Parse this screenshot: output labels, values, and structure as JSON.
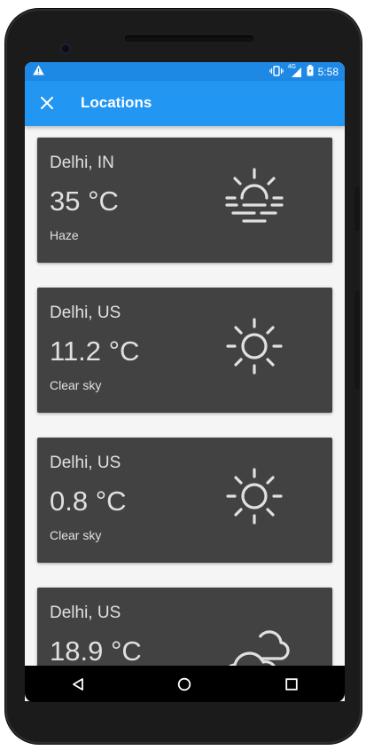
{
  "status_bar": {
    "time": "5:58",
    "network": "4G",
    "icons": [
      "warning-icon",
      "vibrate-icon",
      "signal-icon",
      "battery-icon"
    ]
  },
  "app_bar": {
    "title": "Locations",
    "close_icon": "close-icon"
  },
  "locations": [
    {
      "location": "Delhi, IN",
      "temperature": "35 °C",
      "description": "Haze",
      "icon": "haze-icon"
    },
    {
      "location": "Delhi, US",
      "temperature": "11.2 °C",
      "description": "Clear sky",
      "icon": "sun-icon"
    },
    {
      "location": "Delhi, US",
      "temperature": "0.8 °C",
      "description": "Clear sky",
      "icon": "sun-icon"
    },
    {
      "location": "Delhi, US",
      "temperature": "18.9 °C",
      "description": "",
      "icon": "cloud-icon"
    }
  ],
  "nav_bar": {
    "buttons": [
      "back-icon",
      "home-icon",
      "recents-icon"
    ]
  },
  "colors": {
    "status_bar": "#1e88e5",
    "app_bar": "#2196f3",
    "card": "#424242",
    "background": "#f5f5f5",
    "text_on_card": "#e0e0e0"
  }
}
